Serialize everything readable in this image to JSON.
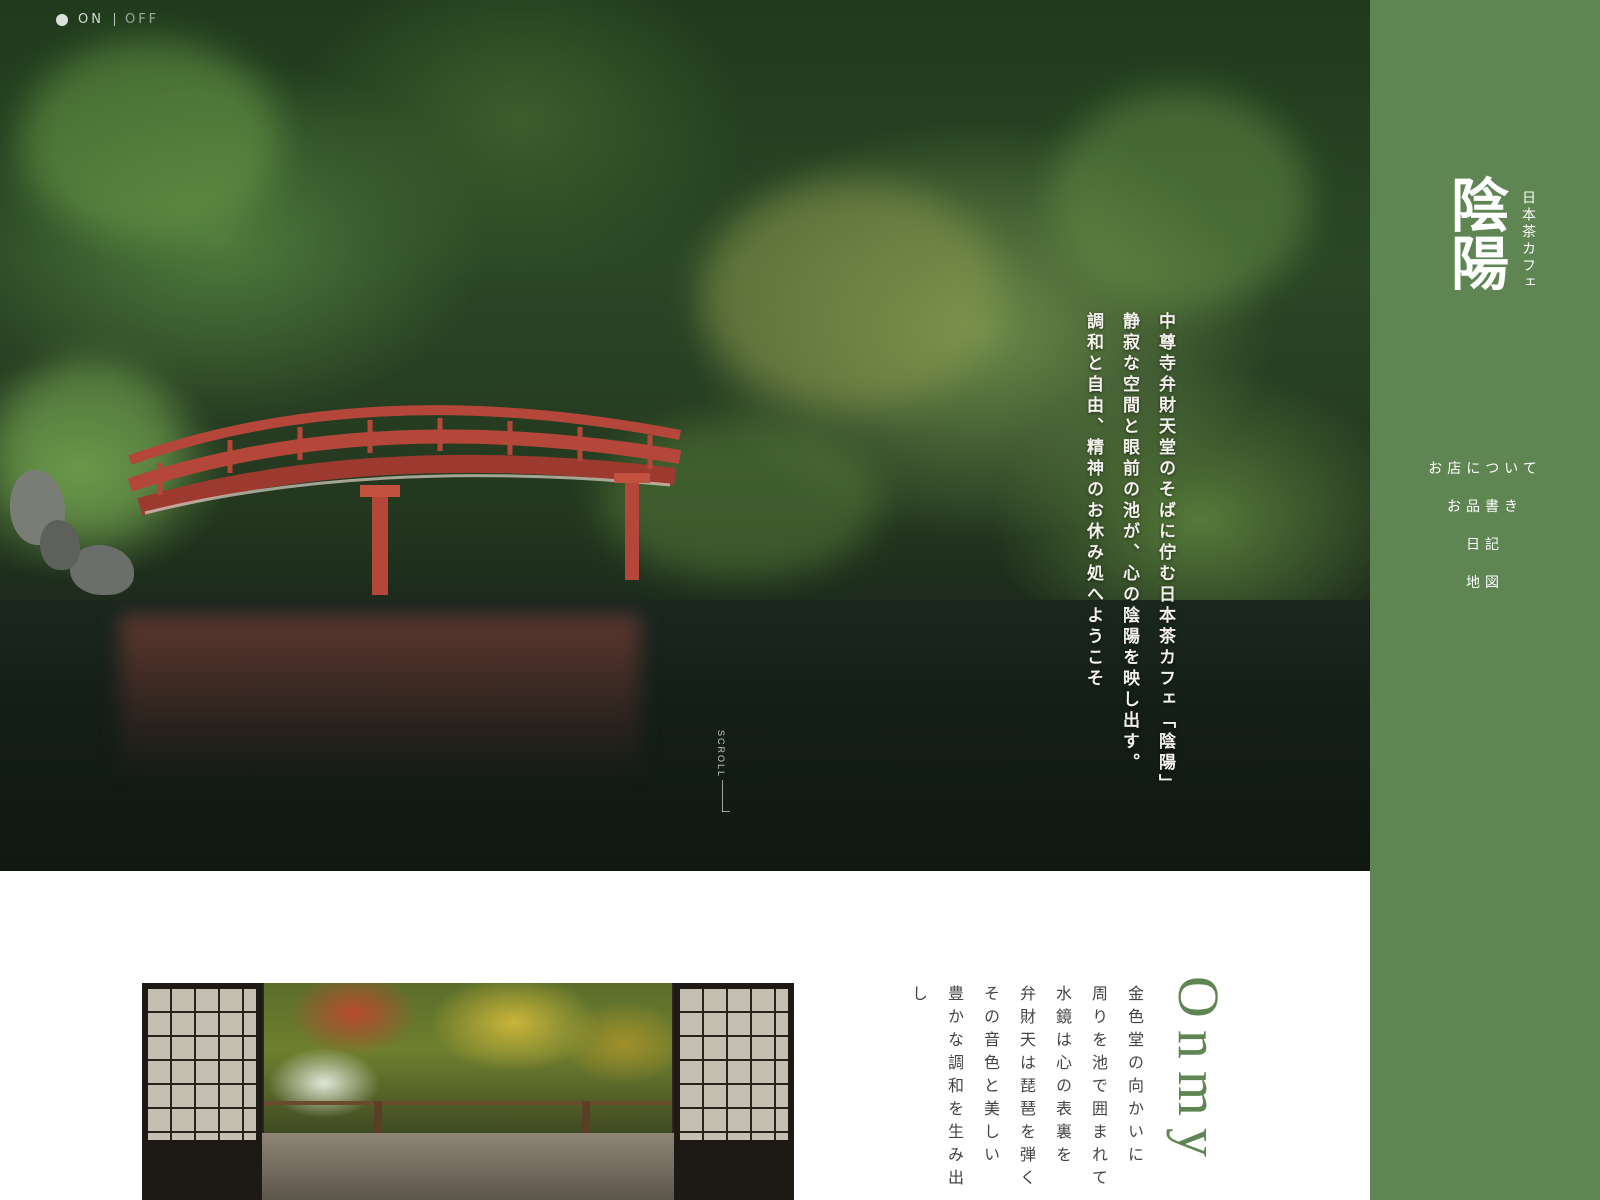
{
  "toggle": {
    "on_label": "ON",
    "off_label": "OFF"
  },
  "hero": {
    "copy_lines": [
      "中尊寺弁財天堂のそばに佇む日本茶カフェ「陰陽」",
      "静寂な空間と眼前の池が、心の陰陽を映し出す。",
      "調和と自由、精神のお休み処へようこそ"
    ],
    "scroll_label": "SCROLL"
  },
  "sidebar": {
    "logo_mark": "陰陽",
    "logo_subtitle": "日本茶カフェ",
    "nav": [
      "お店について",
      "お品書き",
      "日記",
      "地図"
    ]
  },
  "about": {
    "heading": "Onmy",
    "text_lines": [
      "金色堂の向かいに",
      "周りを池で囲まれて",
      "水鏡は心の表裏を",
      "弁財天は琵琶を弾く",
      "その音色と美しい",
      "豊かな調和を生み出し"
    ]
  },
  "colors": {
    "sidebar_bg": "#5e8552",
    "heading_green": "#5e8552",
    "bridge_red": "#b5473a"
  }
}
